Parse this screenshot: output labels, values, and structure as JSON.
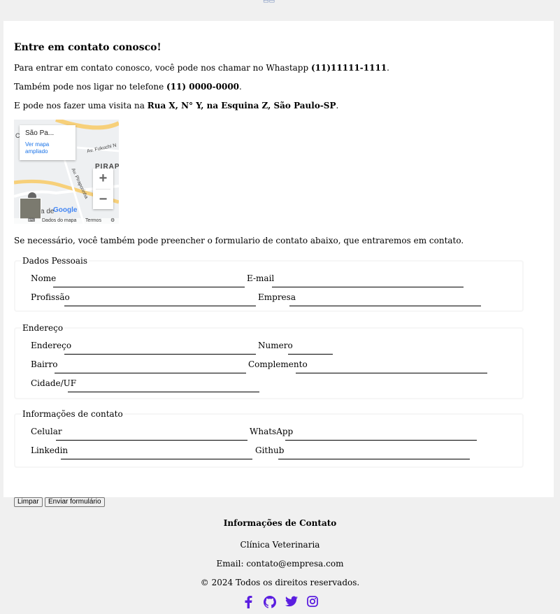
{
  "contact": {
    "title": "Entre em contato conosco!",
    "line1_text": "Para entrar em contato conosco, você pode nos chamar no Whastapp ",
    "line1_bold": "(11)11111-1111",
    "line1_end": ".",
    "line2_text": "Também pode nos ligar no telefone ",
    "line2_bold": "(11) 0000-0000",
    "line2_end": ".",
    "line3_text": "E pode nos fazer uma visita na ",
    "line3_bold": "Rua X, N° Y, na Esquina Z, São Paulo-SP",
    "line3_end": ".",
    "form_intro": "Se necessário, você também pode preencher o formulario de contato abaixo, que entraremos em contato."
  },
  "map": {
    "place": "São Pa...",
    "view_larger": "Ver mapa ampliado",
    "label_pirap": "PIRAP",
    "label_fukuchi": "Av. Fukuchi N",
    "label_piraporinha": "Av. Piraporinha",
    "label_de": "a de",
    "label_c": "C",
    "google": "Google",
    "footer_data": "Dados do mapa",
    "footer_terms": "Termos",
    "zoom_in": "+",
    "zoom_out": "−"
  },
  "form": {
    "personal": {
      "legend": "Dados Pessoais",
      "name_label": "Nome",
      "email_label": "E-mail",
      "profession_label": "Profissão",
      "company_label": "Empresa"
    },
    "address": {
      "legend": "Endereço",
      "address_label": "Endereço",
      "number_label": "Numero",
      "district_label": "Bairro",
      "complement_label": "Complemento",
      "city_label": "Cidade/UF"
    },
    "contact_info": {
      "legend": "Informações de contato",
      "cell_label": "Celular",
      "whatsapp_label": "WhatsApp",
      "linkedin_label": "Linkedin",
      "github_label": "Github"
    },
    "clear_button": "Limpar",
    "submit_button": "Enviar formulário"
  },
  "footer": {
    "title": "Informações de Contato",
    "clinic": "Clínica Veterinaria",
    "email": "Email: contato@empresa.com",
    "copyright": "© 2024 Todos os direitos reservados.",
    "icons": [
      "facebook-icon",
      "github-icon",
      "twitter-icon",
      "instagram-icon"
    ],
    "icon_color": "#5b1ee0"
  }
}
